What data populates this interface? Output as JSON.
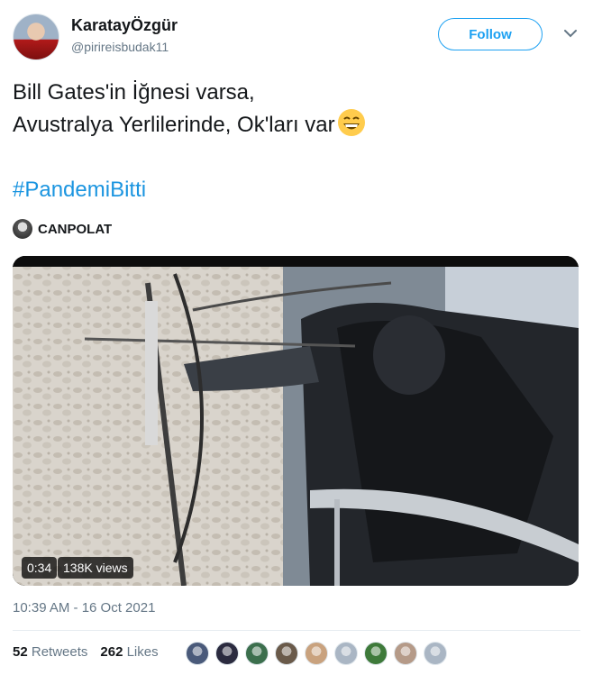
{
  "author": {
    "display_name": "KaratayÖzgür",
    "handle": "@pirireisbudak11"
  },
  "follow_label": "Follow",
  "tweet": {
    "line1": "Bill Gates'in İğnesi varsa,",
    "line2": "Avustralya Yerlilerinde, Ok'ları var",
    "emoji": "grinning-face-emoji",
    "hashtag": "#PandemiBitti"
  },
  "quoted_user": "CANPOLAT",
  "video": {
    "duration": "0:34",
    "views": "138K views"
  },
  "timestamp": "10:39 AM - 16 Oct 2021",
  "stats": {
    "retweets_count": "52",
    "retweets_label": "Retweets",
    "likes_count": "262",
    "likes_label": "Likes"
  },
  "liker_avatars": [
    "#4a5a7a",
    "#2b2b3f",
    "#3c6f4d",
    "#6a5a4a",
    "#c9a27e",
    "#aab6c4",
    "#3e7a3a",
    "#b59a88",
    "#aab6c4"
  ],
  "colors": {
    "accent": "#1da1f2",
    "hashtag": "#1b95e0",
    "muted": "#657786"
  }
}
